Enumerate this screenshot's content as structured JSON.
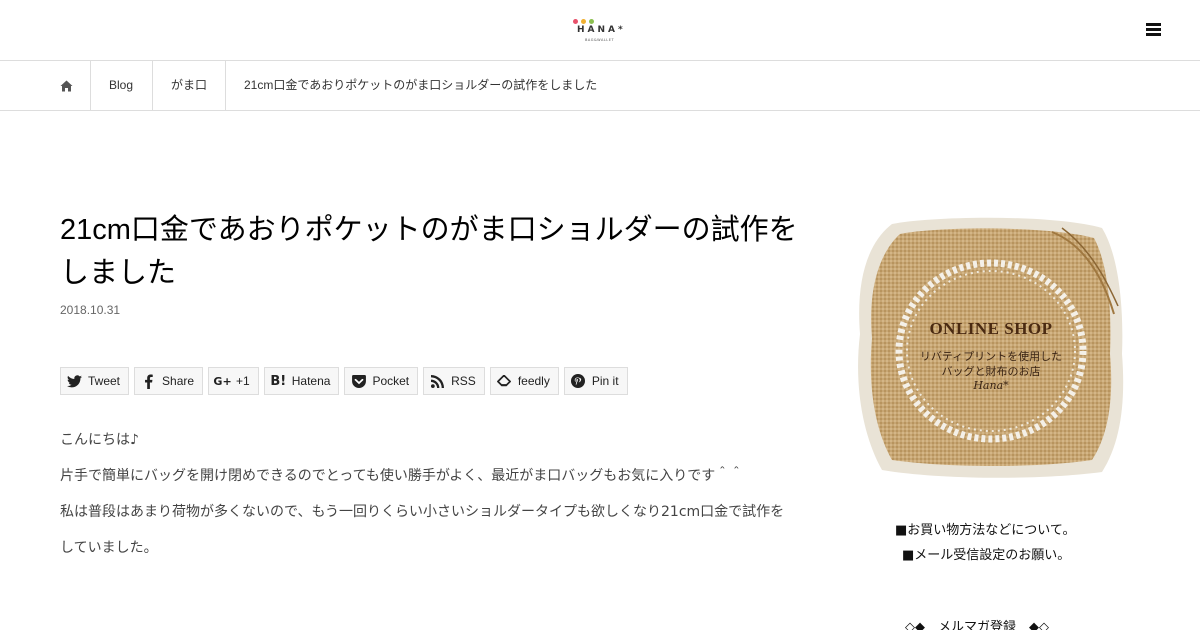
{
  "header": {
    "logo": {
      "brand": "HANA*",
      "sub": "BAG&WALLET",
      "dot_colors": [
        "#e8506a",
        "#f0b030",
        "#8cc050"
      ]
    },
    "menu_icon": "hamburger-menu-icon"
  },
  "breadcrumb": {
    "home_icon": "home-icon",
    "items": [
      "Blog",
      "がま口",
      "21cm口金であおりポケットのがま口ショルダーの試作をしました"
    ]
  },
  "article": {
    "title": "21cm口金であおりポケットのがま口ショルダーの試作をしました",
    "date": "2018.10.31",
    "share": [
      {
        "label": "Tweet",
        "icon": "twitter-icon"
      },
      {
        "label": "Share",
        "icon": "facebook-icon"
      },
      {
        "label": "+1",
        "icon": "google-plus-icon"
      },
      {
        "label": "Hatena",
        "icon": "hatena-icon"
      },
      {
        "label": "Pocket",
        "icon": "pocket-icon"
      },
      {
        "label": "RSS",
        "icon": "rss-icon"
      },
      {
        "label": "feedly",
        "icon": "feedly-icon"
      },
      {
        "label": "Pin it",
        "icon": "pinterest-icon"
      }
    ],
    "paragraphs": [
      "こんにちは♪",
      "片手で簡単にバッグを開け閉めできるのでとっても使い勝手がよく、最近がま口バッグもお気に入りです＾＾",
      "私は普段はあまり荷物が多くないので、もう一回りくらい小さいショルダータイプも欲しくなり21cm口金で試作をしていました。"
    ]
  },
  "sidebar": {
    "banner": {
      "title": "ONLINE SHOP",
      "line1": "リバティプリントを使用した",
      "line2": "バッグと財布のお店",
      "line3": "Hana*"
    },
    "links": [
      "■お買い物方法などについて。",
      "■メール受信設定のお願い。"
    ],
    "mail_magazine": "◇◆　メルマガ登録　◆◇"
  }
}
